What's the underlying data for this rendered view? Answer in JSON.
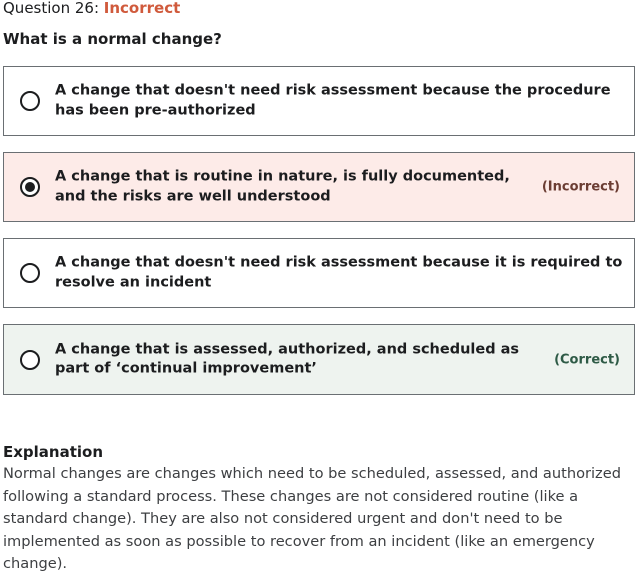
{
  "question": {
    "label": "Question 26:",
    "status": "Incorrect",
    "text": "What is a normal change?"
  },
  "options": [
    {
      "text": "A change that doesn't need risk assessment because the procedure has been pre-authorized",
      "tag": "",
      "selected": false
    },
    {
      "text": "A change that is routine in nature, is fully documented, and the risks are well understood",
      "tag": "(Incorrect)",
      "selected": true
    },
    {
      "text": "A change that doesn't need risk assessment because it is required to resolve an incident",
      "tag": "",
      "selected": false
    },
    {
      "text": "A change that is assessed, authorized, and scheduled as part of ‘continual improvement’",
      "tag": "(Correct)",
      "selected": false
    }
  ],
  "explanation": {
    "title": "Explanation",
    "body": "Normal changes are changes which need to be scheduled, assessed, and authorized following a standard process. These changes are not considered routine (like a standard change). They are also not considered urgent and don't need to be implemented as soon as possible to recover from an incident (like an emergency change)."
  },
  "colors": {
    "incorrect_status": "#d05a3c",
    "incorrect_bg": "#fdebe8",
    "correct_bg": "#eef3ef"
  }
}
